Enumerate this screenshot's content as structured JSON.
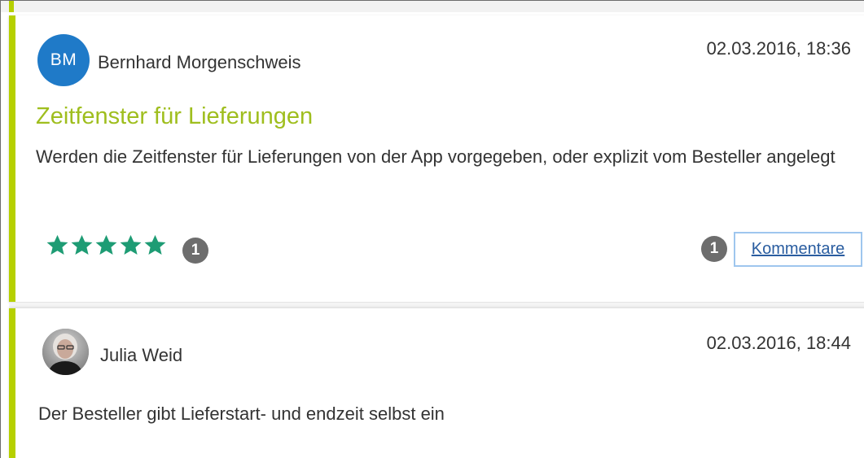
{
  "posts": [
    {
      "author_initials": "BM",
      "author": "Bernhard Morgenschweis",
      "date": "02.03.2016, 18:36",
      "title": "Zeitfenster für Lieferungen",
      "body": "Werden die Zeitfenster für Lieferungen von der App vorgegeben, oder explizit vom Besteller angelegt",
      "rating": {
        "stars": 5,
        "max": 5,
        "count": "1"
      },
      "comments": {
        "count": "1",
        "button_label": "Kommentare"
      }
    },
    {
      "author": "Julia Weid",
      "date": "02.03.2016, 18:44",
      "body": "Der Besteller gibt Lieferstart- und endzeit selbst ein"
    }
  ],
  "colors": {
    "accent": "#b6d000",
    "title": "#9fbe1e",
    "avatar": "#1f7ac8",
    "star": "#1e9c74",
    "badge": "#6d6d6d",
    "link": "#2a5da0"
  }
}
